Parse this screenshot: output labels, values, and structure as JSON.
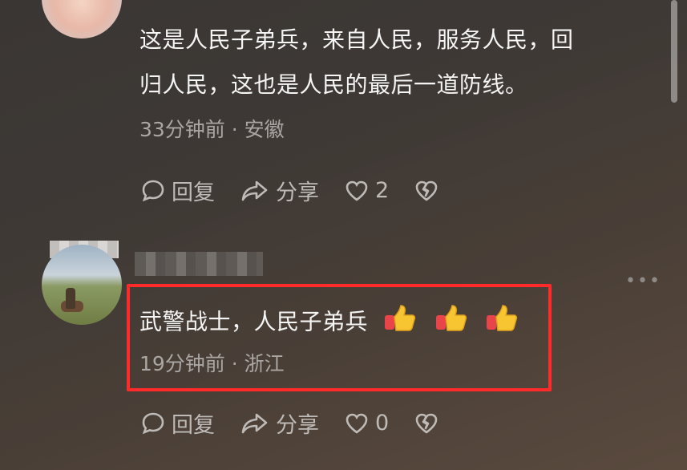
{
  "comments": [
    {
      "text_line1": "这是人民子弟兵，来自人民，服务人民，回",
      "text_line2": "归人民，这也是人民的最后一道防线。",
      "meta": "33分钟前 · 安徽",
      "reply_label": "回复",
      "share_label": "分享",
      "like_count": "2"
    },
    {
      "text": "武警战士，人民子弟兵",
      "emoji": [
        "thumbs-up",
        "thumbs-up",
        "thumbs-up"
      ],
      "meta": "19分钟前 · 浙江",
      "reply_label": "回复",
      "share_label": "分享",
      "like_count": "0"
    }
  ],
  "colors": {
    "highlight": "#ff2a2a",
    "text": "#f5f5f5",
    "meta": "#a9a6a3"
  }
}
